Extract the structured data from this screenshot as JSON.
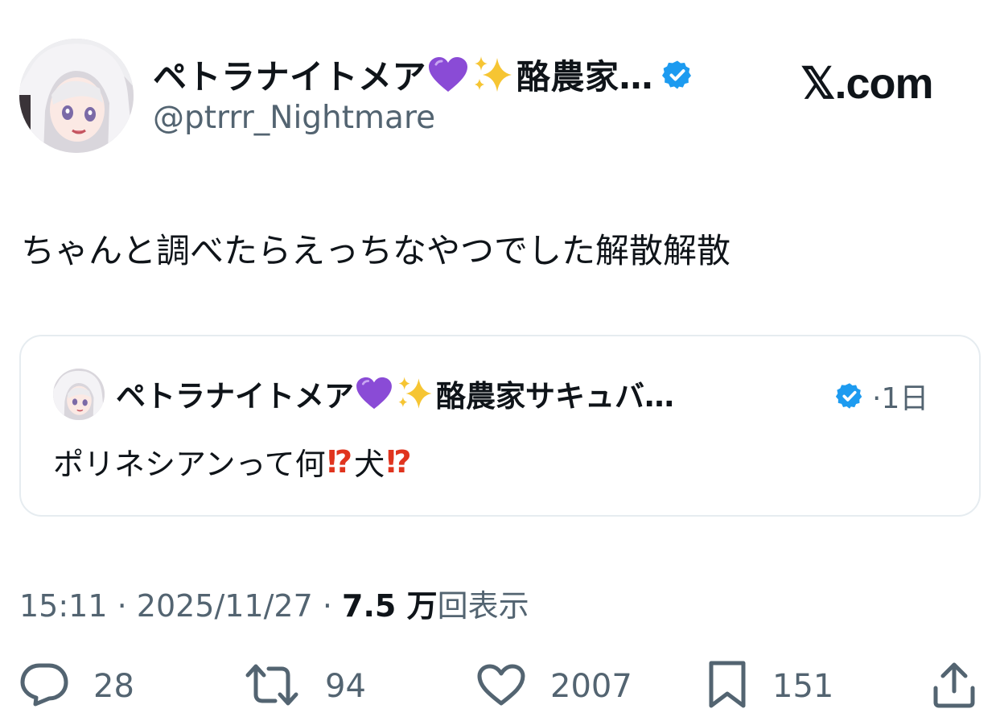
{
  "author": {
    "display_name": "ペトラナイトメア",
    "display_name_suffix": "酪農家…",
    "handle": "@ptrrr_Nightmare",
    "emoji": [
      "purple-heart",
      "sparkles"
    ],
    "verified": true
  },
  "brand": {
    "label": "𝕏.com"
  },
  "tweet": {
    "text": "ちゃんと調べたらえっちなやつでした解散解散"
  },
  "quote": {
    "display_name": "ペトラナイトメア",
    "display_name_suffix": "酪農家サキュバ…",
    "time": "·1日",
    "text_part1": "ポリネシアンって何",
    "text_part2": "犬",
    "emoji": "exclamation-question-mark"
  },
  "meta": {
    "time": "15:11",
    "sep1": " · ",
    "date": "2025/11/27",
    "sep2": " · ",
    "views_count": "7.5 万",
    "views_label": "回表示"
  },
  "actions": {
    "reply_count": "28",
    "retweet_count": "94",
    "like_count": "2007",
    "bookmark_count": "151"
  },
  "colors": {
    "text": "#0f1419",
    "secondary": "#536471",
    "verified": "#1d9bf0",
    "heart_emoji": "#8a4bd6",
    "exclamation": "#e0341e",
    "border": "#e6ecf0"
  }
}
